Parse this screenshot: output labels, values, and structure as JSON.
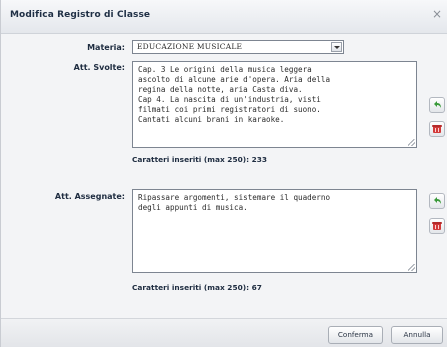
{
  "dialog": {
    "title": "Modifica Registro di Classe",
    "close_icon": "close-icon"
  },
  "form": {
    "materia": {
      "label": "Materia:",
      "selected": "EDUCAZIONE MUSICALE"
    },
    "att_svolte": {
      "label": "Att. Svolte:",
      "text": "Cap. 3 Le origini della musica leggera\nascolto di alcune arie d'opera. Aria della\nregina della notte, aria Casta diva.\nCap 4. La nascita di un'industria, visti\nfilmati coi primi registratori di suono.\nCantati alcuni brani in karaoke.",
      "counter": "Caratteri inseriti (max 250): 233"
    },
    "att_assegnate": {
      "label": "Att. Assegnate:",
      "text": "Ripassare argomenti, sistemare il quaderno\ndegli appunti di musica.",
      "counter": "Caratteri inseriti (max 250): 67"
    },
    "side_buttons": {
      "undo_icon": "undo-arrow-icon",
      "delete_icon": "delete-icon"
    }
  },
  "footer": {
    "confirm_label": "Conferma",
    "cancel_label": "Annulla"
  },
  "colors": {
    "title_text": "#1f2f45",
    "undo_green": "#3a9a3a",
    "delete_red": "#d23a3a"
  }
}
